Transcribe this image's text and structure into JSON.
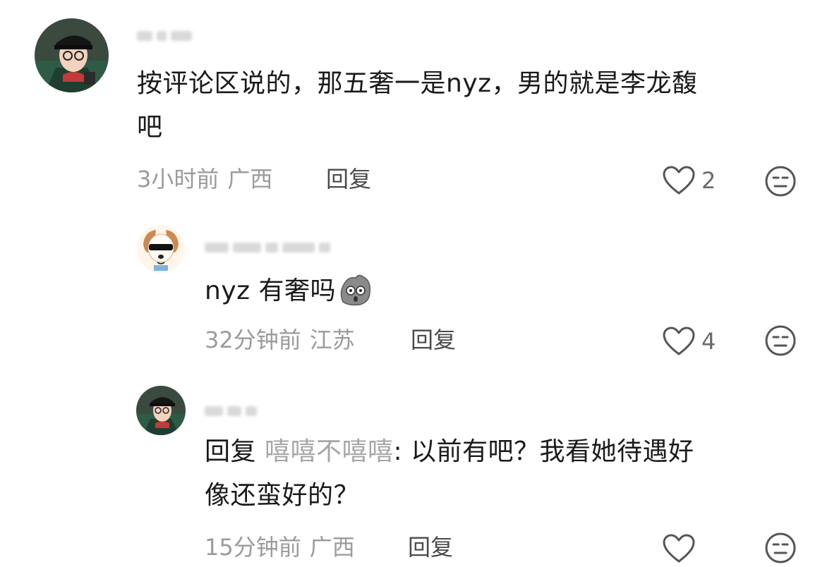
{
  "comments": [
    {
      "username": "",
      "text": "按评论区说的，那五奢一是nyz，男的就是李龙馥吧",
      "text_line1": "按评论区说的，那五奢一是nyz，男的就是李龙馥",
      "text_line2": "吧",
      "time": "3小时前",
      "location": "广西",
      "reply_label": "回复",
      "likes": "2",
      "avatar_icon": "user-avatar-glasses-cap"
    },
    {
      "username": "",
      "text": "nyz 有奢吗",
      "inline_emoji": "shocked-rock-emoji",
      "time": "32分钟前",
      "location": "江苏",
      "reply_label": "回复",
      "likes": "4",
      "avatar_icon": "user-avatar-dog-sunglasses"
    },
    {
      "username": "",
      "reply_prefix": "回复",
      "reply_to": "嘻嘻不嘻嘻",
      "text_line1": ": 以前有吧？我看她待遇好",
      "text_line2": "像还蛮好的？",
      "time": "15分钟前",
      "location": "广西",
      "reply_label": "回复",
      "likes": "",
      "avatar_icon": "user-avatar-glasses-cap"
    }
  ],
  "colors": {
    "text": "#1a1a1a",
    "meta": "#9b9b9b",
    "reply_name": "#a6a6a6",
    "icon": "#555555"
  }
}
